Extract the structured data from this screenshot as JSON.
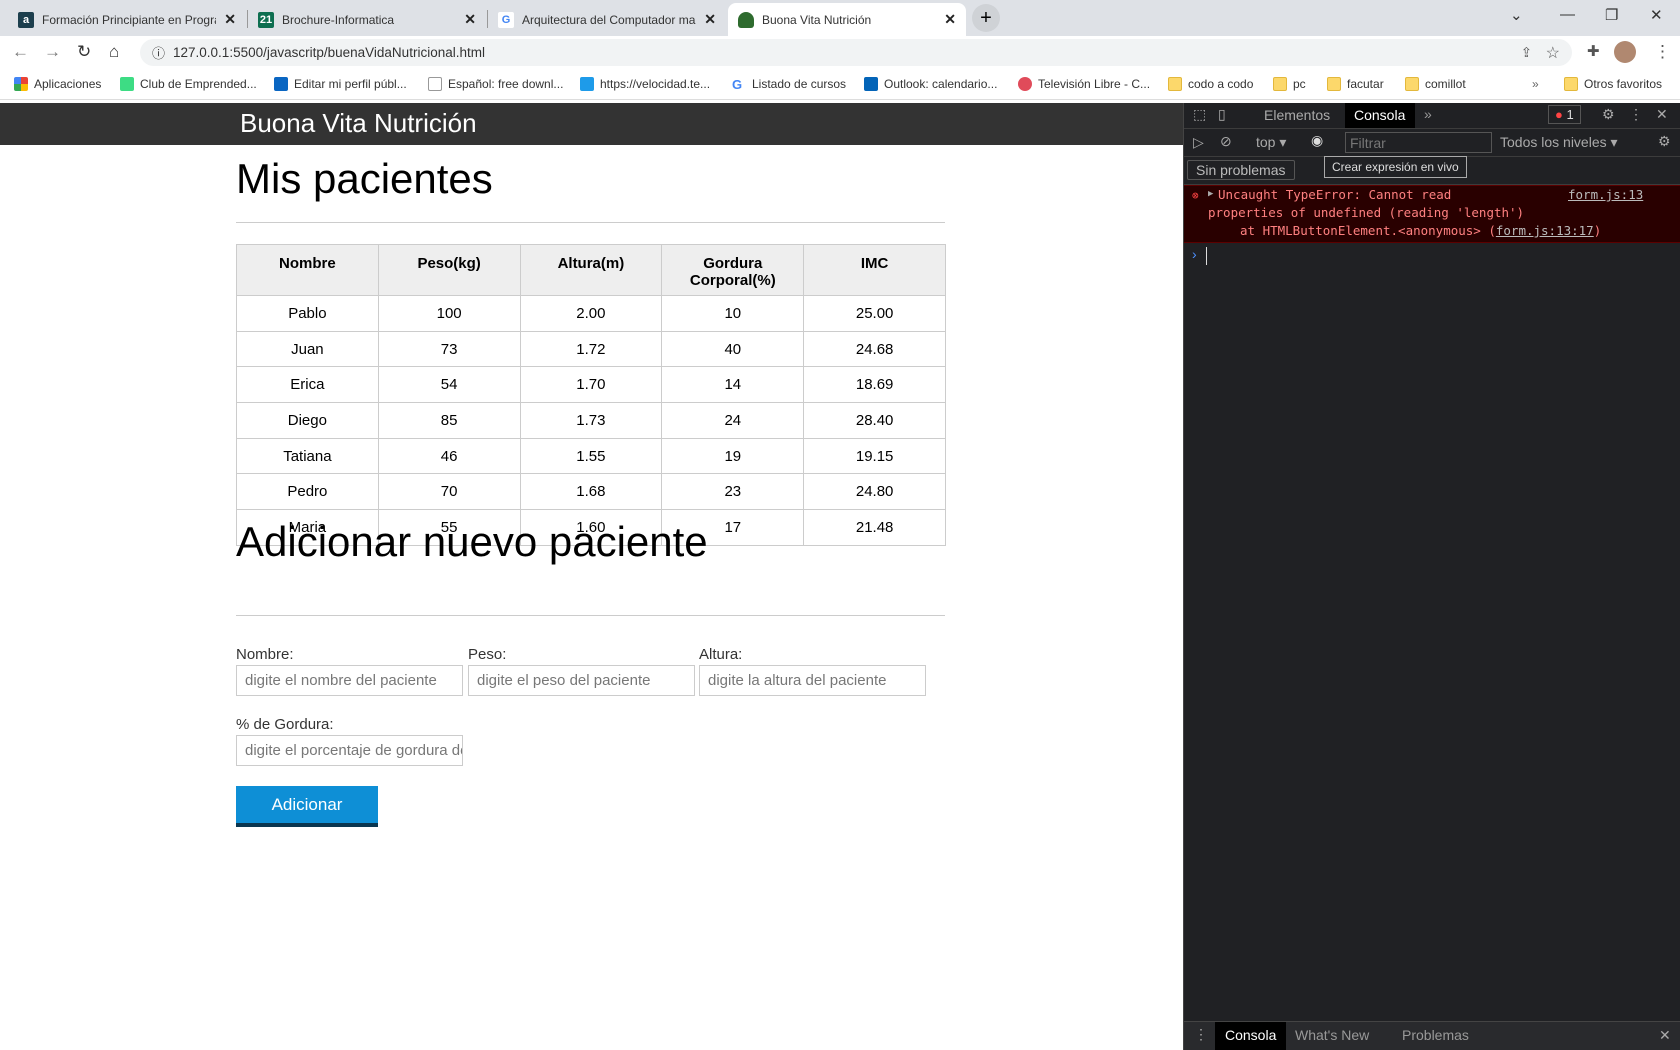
{
  "browser": {
    "tabs": [
      {
        "title": "Formación Principiante en Progra",
        "icon": "alura-icon",
        "color": "#1c3e4d"
      },
      {
        "title": "Brochure-Informatica",
        "icon": "brochure-icon",
        "color": "#0d6e50"
      },
      {
        "title": "Arquitectura del Computador ma",
        "icon": "google-icon",
        "color": "#4285f4"
      },
      {
        "title": "Buona Vita Nutrición",
        "icon": "apple-icon",
        "color": "#2e6b2e"
      }
    ],
    "url": "127.0.0.1:5500/javascritp/buenaVidaNutricional.html",
    "bookmarks": [
      "Aplicaciones",
      "Club de Emprended...",
      "Editar mi perfil públ...",
      "Español: free downl...",
      "https://velocidad.te...",
      "Listado de cursos",
      "Outlook: calendario...",
      "Televisión Libre - C...",
      "codo a codo",
      "pc",
      "facutar",
      "comillot"
    ],
    "other_bookmarks": "Otros favoritos",
    "more": "»"
  },
  "page": {
    "site_title": "Buona Vita Nutrición",
    "heading": "Mis pacientes",
    "table": {
      "headers": [
        "Nombre",
        "Peso(kg)",
        "Altura(m)",
        "Gordura Corporal(%)",
        "IMC"
      ],
      "rows": [
        [
          "Pablo",
          "100",
          "2.00",
          "10",
          "25.00"
        ],
        [
          "Juan",
          "73",
          "1.72",
          "40",
          "24.68"
        ],
        [
          "Erica",
          "54",
          "1.70",
          "14",
          "18.69"
        ],
        [
          "Diego",
          "85",
          "1.73",
          "24",
          "28.40"
        ],
        [
          "Tatiana",
          "46",
          "1.55",
          "19",
          "19.15"
        ],
        [
          "Pedro",
          "70",
          "1.68",
          "23",
          "24.80"
        ],
        [
          "Maria",
          "55",
          "1.60",
          "17",
          "21.48"
        ]
      ]
    },
    "form_heading": "Adicionar nuevo paciente",
    "form": {
      "nombre": {
        "label": "Nombre:",
        "placeholder": "digite el nombre del paciente"
      },
      "peso": {
        "label": "Peso:",
        "placeholder": "digite el peso del paciente"
      },
      "altura": {
        "label": "Altura:",
        "placeholder": "digite la altura del paciente"
      },
      "gordura": {
        "label": "% de Gordura:",
        "placeholder": "digite el porcentaje de gordura del paciente"
      },
      "submit": "Adicionar"
    },
    "accent": "#0e8fd6"
  },
  "devtools": {
    "tabs": [
      "Elementos",
      "Consola"
    ],
    "more": "»",
    "error_count": "1",
    "context": "top",
    "filter_placeholder": "Filtrar",
    "levels": "Todos los niveles",
    "issues": "Sin problemas",
    "tooltip": "Crear expresión en vivo",
    "error": {
      "line1": "Uncaught TypeError: Cannot read",
      "line2": "properties of undefined (reading 'length')",
      "line3_prefix": "at HTMLButtonElement.<anonymous> (",
      "line3_link": "form.js:13:17",
      "line3_suffix": ")",
      "source": "form.js:13"
    },
    "drawer_tabs": [
      "Consola",
      "What's New",
      "Problemas"
    ]
  }
}
